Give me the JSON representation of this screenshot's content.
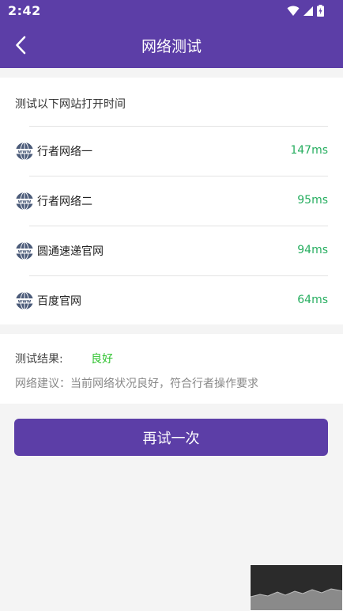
{
  "status_bar": {
    "time": "2:42"
  },
  "header": {
    "title": "网络测试",
    "back_icon": "chevron-left-icon"
  },
  "test": {
    "heading": "测试以下网站打开时间",
    "items": [
      {
        "name": "行者网络一",
        "latency": "147ms",
        "icon": "globe-www-icon"
      },
      {
        "name": "行者网络二",
        "latency": "95ms",
        "icon": "globe-www-icon"
      },
      {
        "name": "圆通速递官网",
        "latency": "94ms",
        "icon": "globe-www-icon"
      },
      {
        "name": "百度官网",
        "latency": "64ms",
        "icon": "globe-www-icon"
      }
    ]
  },
  "result": {
    "label": "测试结果:",
    "value": "良好",
    "advice": "网络建议：当前网络状况良好，符合行者操作要求"
  },
  "actions": {
    "retry_label": "再试一次"
  },
  "colors": {
    "primary": "#5c3ea7",
    "latency": "#27ae60",
    "result_good": "#2ec22e"
  }
}
